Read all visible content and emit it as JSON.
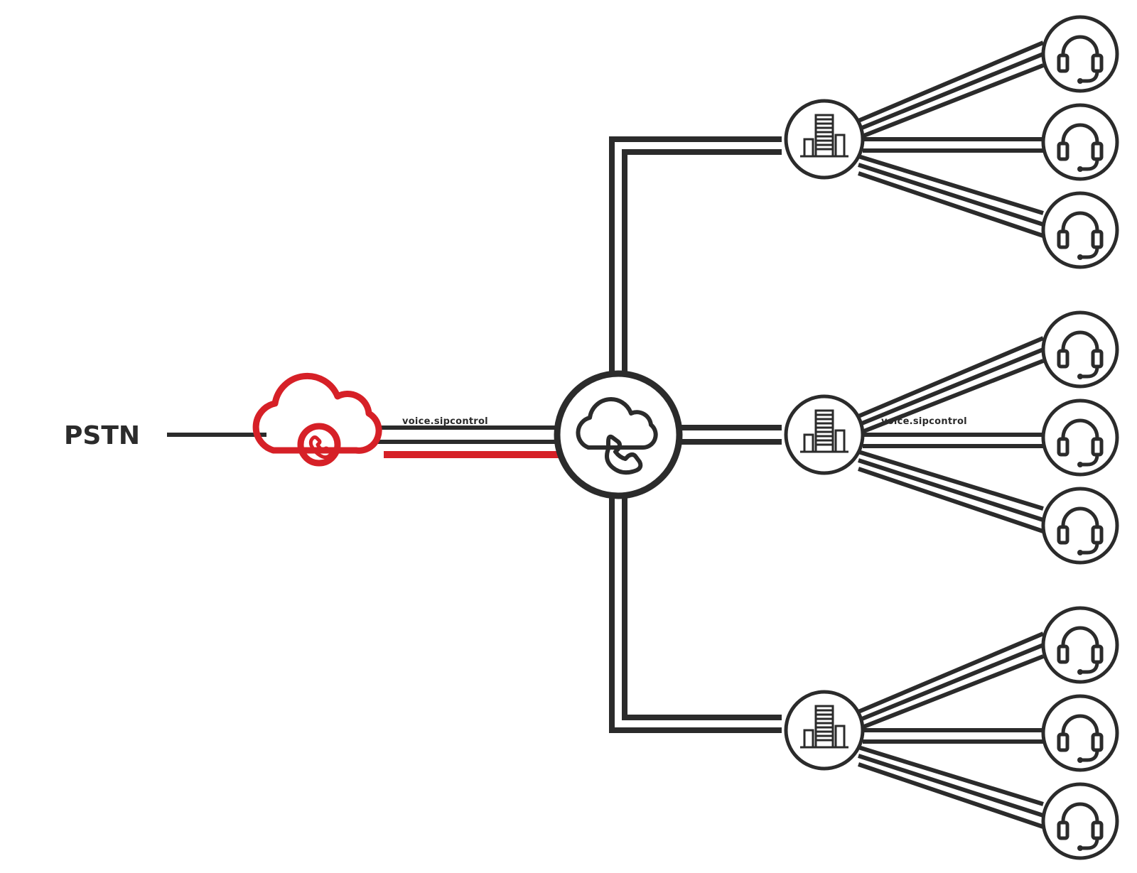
{
  "source_label": "PSTN",
  "connection_labels": [
    "voice.sipcontrol"
  ],
  "colors": {
    "accent": "#d62027",
    "ink": "#2b2b2b",
    "white": "#ffffff"
  },
  "nodes": {
    "carrier_cloud": "telephony-cloud-icon",
    "hosted_pbx": "cloud-pbx-icon",
    "site": "office-building-icon",
    "endpoint": "headset-icon"
  },
  "fanout": {
    "sites": 3,
    "endpoints_per_site": 3
  }
}
